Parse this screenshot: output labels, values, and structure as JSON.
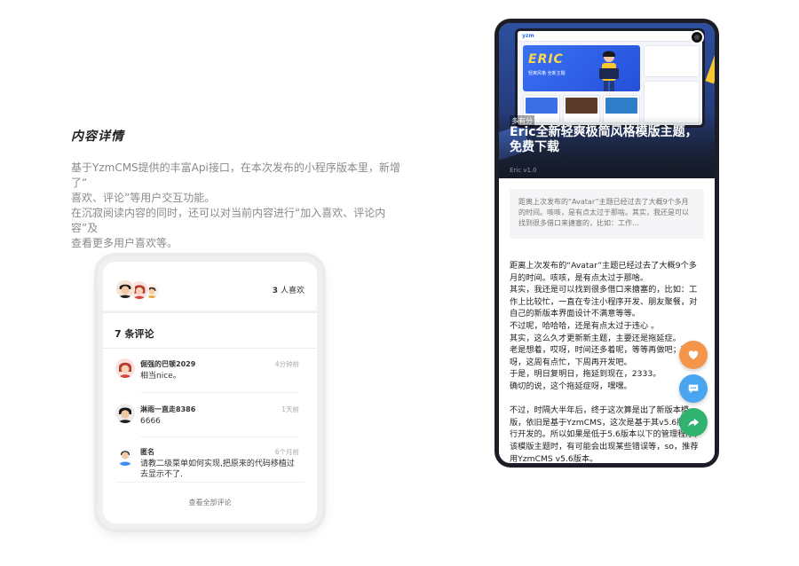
{
  "section": {
    "title": "内容详情",
    "desc_lines": [
      "基于YzmCMS提供的丰富Api接口，在本次发布的小程序版本里，新增了“",
      "喜欢、评论”等用户交互功能。",
      "在沉寂阅读内容的同时，还可以对当前内容进行“加入喜欢、评论内容”及",
      "查看更多用户喜欢等。"
    ]
  },
  "likes": {
    "count": "3",
    "label": "人喜欢"
  },
  "comments": {
    "title": "7 条评论",
    "items": [
      {
        "name": "倔强的巴顿2029",
        "time": "4分钟前",
        "text": "相当nice。"
      },
      {
        "name": "淋雨一直走8386",
        "time": "1天前",
        "text": "6666"
      },
      {
        "name": "匿名",
        "time": "6个月前",
        "text": "请教二级菜单如何实现,把原来的代码移植过去显示不了."
      }
    ],
    "view_all": "查看全部评论"
  },
  "article": {
    "category": "多有分",
    "title": "Eric全新轻爽极简风格模版主题，免费下载",
    "meta": "Eric  v1.0",
    "excerpt": "距离上次发布的“Avatar”主题已经过去了大概9个多月的时间。咳咳，是有点太过于那啥。其实，我还是可以找到很多借口来搪塞的，比如：工作...",
    "paragraphs": [
      "距离上次发布的“Avatar”主题已经过去了大概9个多月的时间。咳咳，是有点太过于那啥。",
      "其实，我还是可以找到很多借口来搪塞的，比如：工作上比较忙，一直在专注小程序开发、朋友聚餐，对自己的新版本界面设计不满意等等。",
      "不过呢，哈哈哈，还是有点太过于违心 。",
      "其实，这么久才更新新主题，主要还是拖延症。",
      "老是想着，哎呀，时间还多着呢，等等再做吧；哎呀，这周有点忙，下周再开发吧。",
      "于是，明日复明日，拖延到现在，2333。",
      "确切的说，这个拖延症呀，嘿嘿。",
      "",
      "不过，时隔大半年后，终于这次算是出了新版本模版，依旧是基于YzmCMS，这次是基于其v5.6版本进行开发的。所以如果是低于5.6版本以下的管理程序，该模版主题时，有可能会出现某些错误等，so，推荐用YzmCMS v5.6版本。"
    ],
    "banner": {
      "logo": "yzm",
      "eric": "ERIC",
      "sub": "轻爽风格  全新主题"
    }
  },
  "colors": {
    "like": "#f5954a",
    "comment": "#4aa5f0",
    "share": "#2fb36f"
  }
}
